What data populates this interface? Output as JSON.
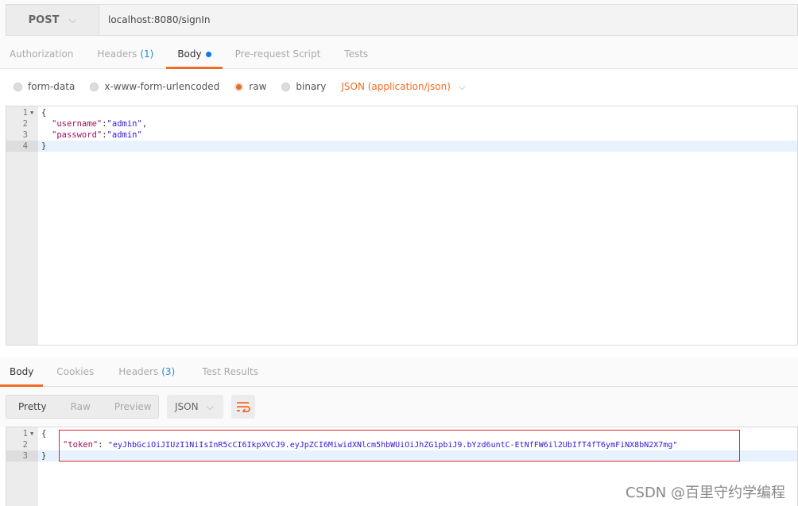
{
  "request": {
    "method": "POST",
    "url": "localhost:8080/signIn"
  },
  "request_tabs": [
    {
      "label": "Authorization"
    },
    {
      "label": "Headers",
      "count": "(1)"
    },
    {
      "label": "Body",
      "active": true
    },
    {
      "label": "Pre-request Script"
    },
    {
      "label": "Tests"
    }
  ],
  "body_modes": [
    {
      "label": "form-data"
    },
    {
      "label": "x-www-form-urlencoded"
    },
    {
      "label": "raw",
      "selected": true
    },
    {
      "label": "binary"
    }
  ],
  "content_type": "JSON (application/json)",
  "request_body": {
    "line_numbers": [
      "1",
      "2",
      "3",
      "4"
    ],
    "l1": "{",
    "l2_key": "\"username\"",
    "l2_val": "\"admin\"",
    "l3_key": "\"password\"",
    "l3_val": "\"admin\"",
    "l4": "}",
    "colon": ":",
    "comma": ","
  },
  "response_tabs": [
    {
      "label": "Body",
      "active": true
    },
    {
      "label": "Cookies"
    },
    {
      "label": "Headers",
      "count": "(3)"
    },
    {
      "label": "Test Results"
    }
  ],
  "view_modes": [
    "Pretty",
    "Raw",
    "Preview"
  ],
  "format": "JSON",
  "response_body": {
    "line_numbers": [
      "1",
      "2",
      "3"
    ],
    "l1": "{",
    "key": "\"token\"",
    "colon": ": ",
    "value": "\"eyJhbGciOiJIUzI1NiIsInR5cCI6IkpXVCJ9.eyJpZCI6MiwidXNlcm5hbWUiOiJhZG1pbiJ9.bYzd6untC-EtNfFW6il2UbIfT4fT6ymFiNX8bN2X7mg\"",
    "l3": "}"
  },
  "watermark": "CSDN @百里守约学编程",
  "colors": {
    "accent": "#f26b22",
    "count": "#1a8fe0",
    "highlight": "#e8202a"
  }
}
